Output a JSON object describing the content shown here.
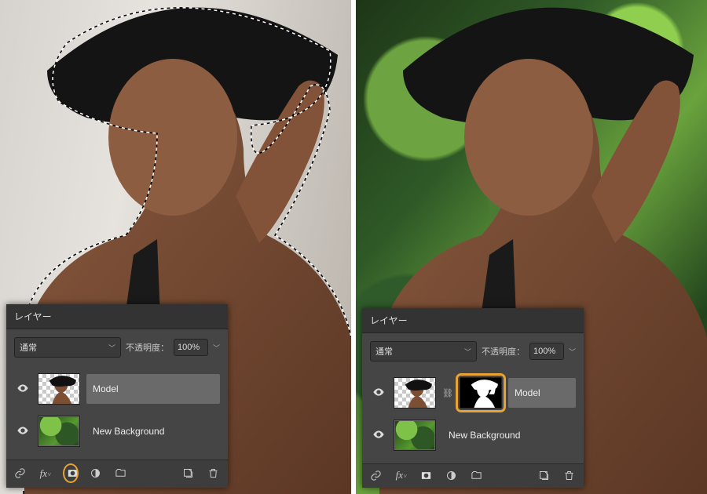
{
  "panel_title": "レイヤー",
  "blend_mode": {
    "value": "通常"
  },
  "opacity": {
    "label": "不透明度：",
    "value": "100%"
  },
  "layers": [
    {
      "name": "Model"
    },
    {
      "name": "New Background"
    }
  ],
  "footer_icons": {
    "link": "link-icon",
    "fx": "fx",
    "mask": "add-mask-icon",
    "adjust": "adjustment-icon",
    "group": "group-icon",
    "new": "new-layer-icon",
    "trash": "trash-icon"
  }
}
